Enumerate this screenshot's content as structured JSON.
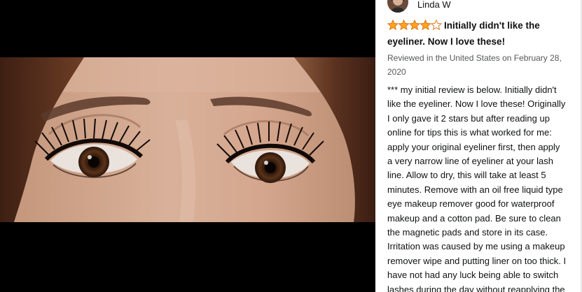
{
  "reviewer": {
    "name": "Linda W"
  },
  "review": {
    "rating": 4,
    "rating_max": 5,
    "title_line1": "Initially didn't like the",
    "title_line2": "eyeliner. Now I love these!",
    "date_line1": "Reviewed in the United States on February 28,",
    "date_line2": "2020",
    "body_lines": [
      "*** my initial review is below. Initially didn't",
      "like the eyeliner. Now I love these! Originally",
      "I only gave it 2 stars but after reading up",
      "online for tips this is what worked for me:",
      "apply your original eyeliner first, then apply",
      "a very narrow line of eyeliner at your lash",
      "line. Allow to dry, this will take at least 5",
      "minutes. Remove with an oil free liquid type",
      "eye makeup remover good for waterproof",
      "makeup and a cotton pad. Be sure to clean",
      "the magnetic pads and store in its case.",
      "Irritation was caused by me using a makeup",
      "remover wipe and putting liner on too thick. I",
      "have not had any luck being able to switch",
      "lashes during the day without reapplying the"
    ]
  },
  "colors": {
    "star": "#FFA41C",
    "star_outline": "#DE7921",
    "viewer_bg": "#000000",
    "text": "#0F1111",
    "meta": "#565959"
  },
  "icons": {
    "avatar": "reviewer-avatar",
    "rating": "star-rating-icon"
  }
}
